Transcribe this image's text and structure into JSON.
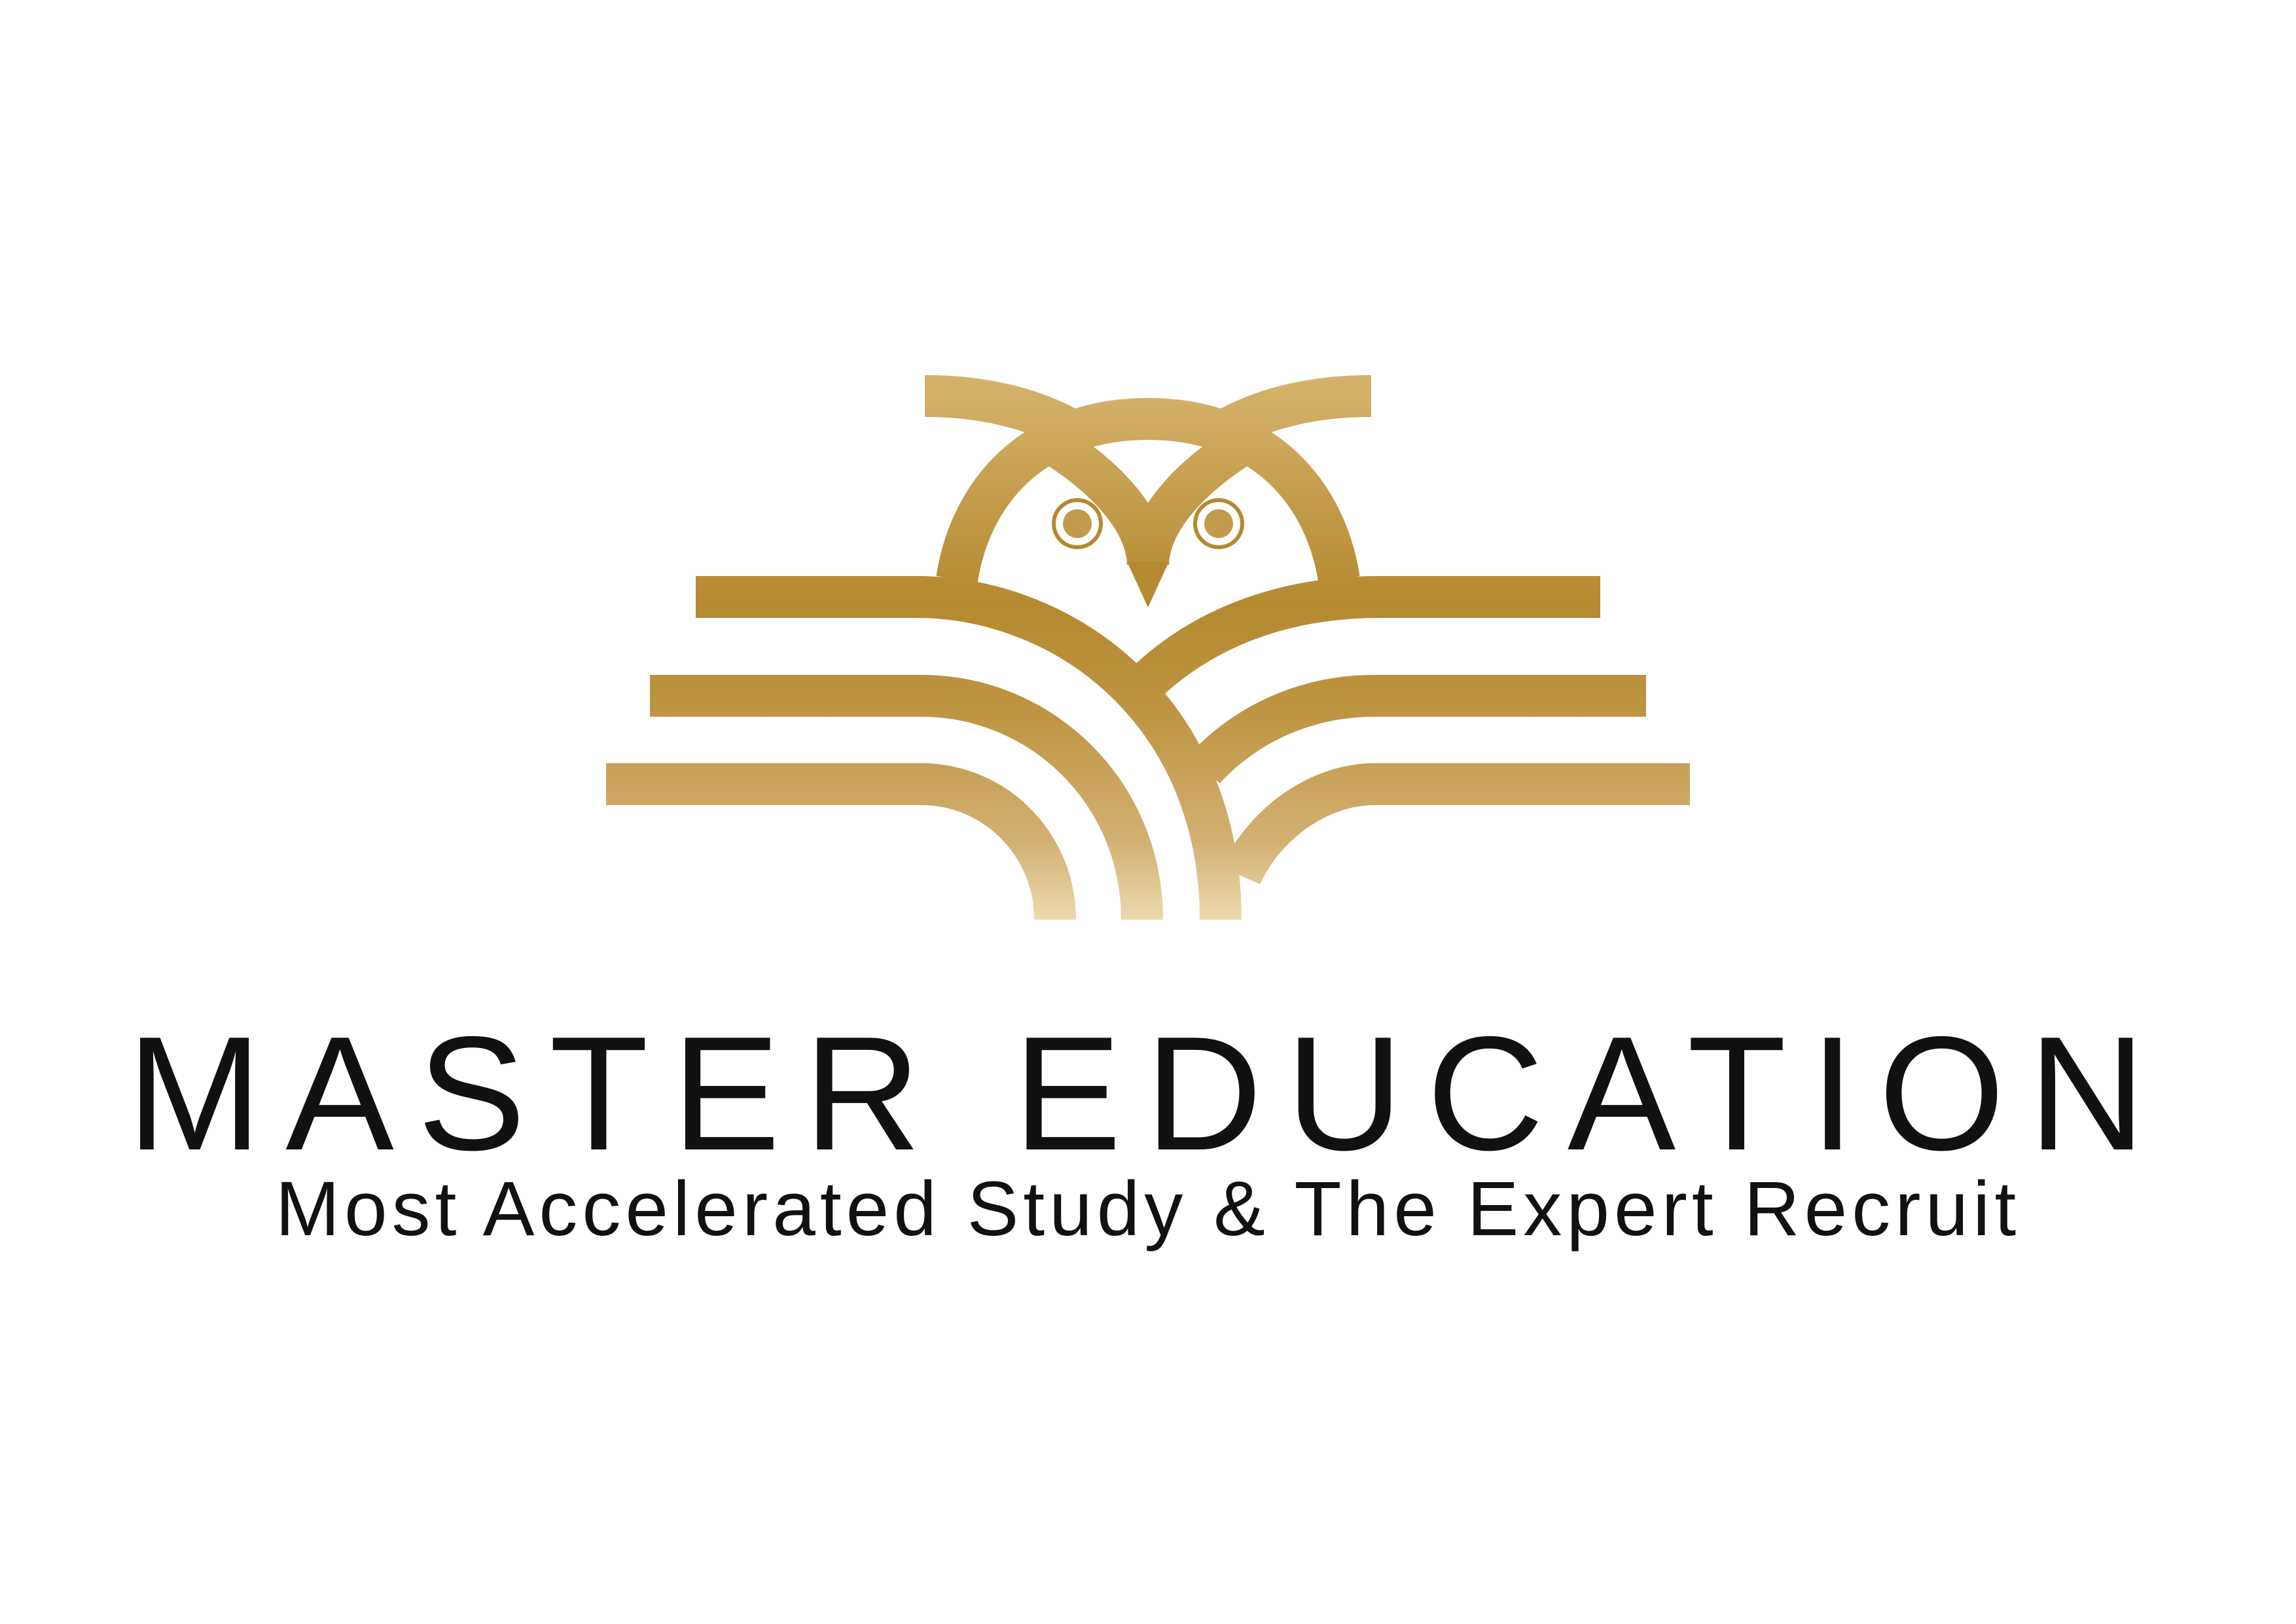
{
  "logo": {
    "icon": "owl-book-icon",
    "colors": {
      "gold_light": "#e8d7a8",
      "gold_mid": "#d1ac66",
      "gold_dark": "#b5892f"
    }
  },
  "brand": {
    "name": "MASTER EDUCATION",
    "tagline": "Most Accelerated Study & The Expert Recruit"
  }
}
